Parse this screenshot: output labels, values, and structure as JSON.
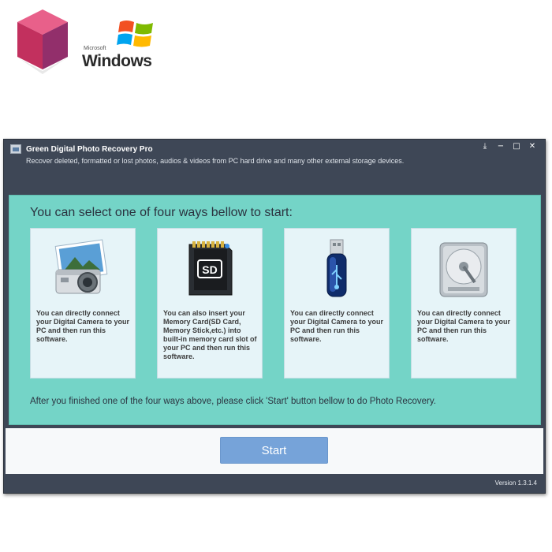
{
  "promo": {
    "windows_small": "Microsoft",
    "windows_big": "Windows",
    "product_logo_icon": "product-box-icon",
    "windows_logo_icon": "windows-flag-icon"
  },
  "window": {
    "title": "Green Digital Photo Recovery Pro",
    "subtitle": "Recover deleted, formatted or lost photos, audios & videos from PC hard drive and many other external storage devices.",
    "controls": {
      "save_glyph": "⤓",
      "minimize_glyph": "−",
      "maximize_glyph": "□",
      "close_glyph": "✕"
    }
  },
  "main": {
    "heading": "You can select one of four ways bellow to start:",
    "cards": [
      {
        "icon": "camera-icon",
        "text": "You can directly connect your Digital Camera to your PC and then run this software."
      },
      {
        "icon": "sd-card-icon",
        "text": "You can also insert your Memory Card(SD Card, Memory Stick,etc.) into built-in memory card slot of your PC and then run this software."
      },
      {
        "icon": "usb-drive-icon",
        "text": "You can directly connect your Digital Camera to your PC and then run this software."
      },
      {
        "icon": "hard-drive-icon",
        "text": "You can directly connect your Digital Camera to your PC and then run this software."
      }
    ],
    "sd_label": "SD",
    "after_text": "After you finished one of the four ways above, please click 'Start' button bellow to do Photo Recovery."
  },
  "footer": {
    "start_label": "Start",
    "version": "Version 1.3.1.4"
  },
  "colors": {
    "titlebar": "#3e4756",
    "panel": "#74d4c7",
    "card": "#e6f4f8",
    "start_button": "#76a3d9"
  }
}
